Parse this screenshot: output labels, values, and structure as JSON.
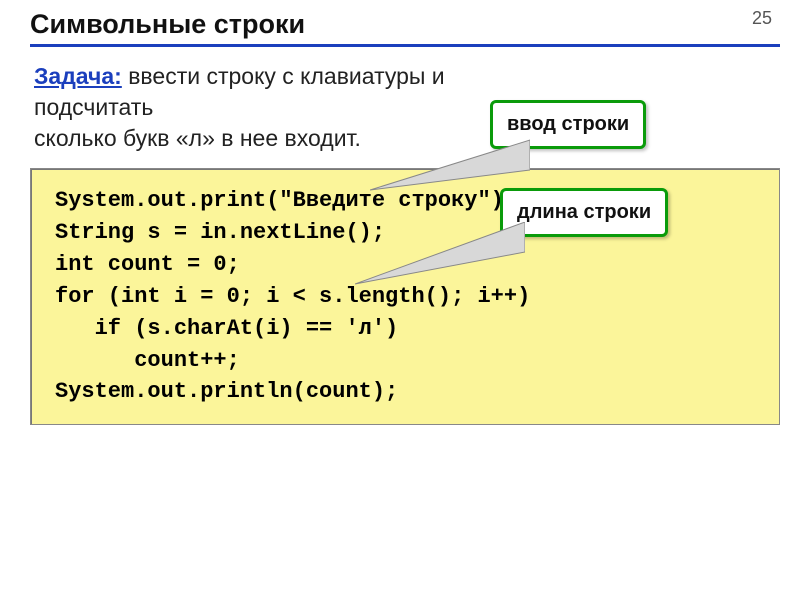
{
  "page_number": "25",
  "title": "Символьные строки",
  "task": {
    "label": "Задача:",
    "text_line1": " ввести строку с клавиатуры и подсчитать",
    "text_line2": "сколько букв «л» в нее входит."
  },
  "code": {
    "l1": "System.out.print(\"Введите строку\");",
    "l2": "String s = in.nextLine();",
    "l3": "int count = 0;",
    "l4": "for (int i = 0; i < s.length(); i++)",
    "l5": "   if (s.charAt(i) == 'л')",
    "l6": "      count++;",
    "l7": "System.out.println(count);"
  },
  "callouts": {
    "input": "ввод строки",
    "length": "длина строки"
  }
}
